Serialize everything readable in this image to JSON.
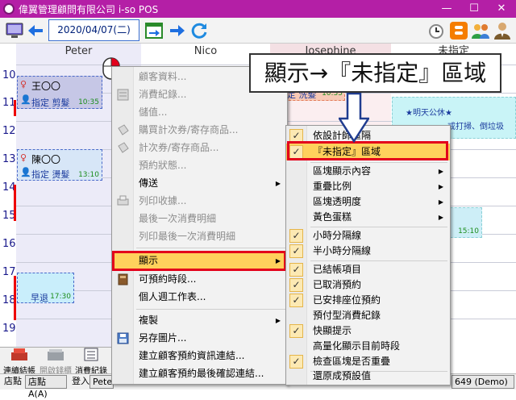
{
  "titlebar": {
    "title": "偉翼管理顧問有限公司 i-so POS",
    "minimize": "—",
    "maximize": "☐",
    "close": "✕"
  },
  "toolbar": {
    "date": "2020/04/07(二)"
  },
  "columns": [
    "Peter",
    "Nico",
    "Josephine",
    "未指定"
  ],
  "hours": [
    "10",
    "11",
    "12",
    "13",
    "14",
    "15",
    "16",
    "17",
    "18",
    "19"
  ],
  "appointments": [
    {
      "name": "王〇〇",
      "service": "指定 剪髮",
      "time": "10:35"
    },
    {
      "name": "陳〇〇",
      "service": "指定 燙髮",
      "time": "13:10"
    },
    {
      "name": "早退",
      "time": "17:30"
    },
    {
      "service": "定 洗髮",
      "time": "10:35"
    },
    {
      "name": "★明天公休★",
      "service": "戒打掃、倒垃圾"
    },
    {
      "time": "15:10"
    }
  ],
  "callout": "顯示→『未指定』區域",
  "context_menu": [
    {
      "label": "顧客資料...",
      "enabled": false
    },
    {
      "label": "消費紀錄...",
      "enabled": false
    },
    {
      "label": "儲值...",
      "enabled": false
    },
    {
      "label": "購買計次券/寄存商品...",
      "enabled": false
    },
    {
      "label": "計次券/寄存商品...",
      "enabled": false
    },
    {
      "label": "預約狀態...",
      "enabled": false
    },
    {
      "label": "傳送",
      "enabled": true
    },
    {
      "label": "列印收據...",
      "enabled": false
    },
    {
      "label": "最後一次消費明細",
      "enabled": false
    },
    {
      "label": "列印最後一次消費明細",
      "enabled": false
    },
    {
      "label": "顯示",
      "enabled": true
    },
    {
      "label": "可預約時段...",
      "enabled": true
    },
    {
      "label": "個人週工作表...",
      "enabled": true
    },
    {
      "label": "複製",
      "enabled": true
    },
    {
      "label": "另存圖片...",
      "enabled": true
    },
    {
      "label": "建立顧客預約資訊連結...",
      "enabled": true
    },
    {
      "label": "建立顧客預約最後確認連結...",
      "enabled": true
    }
  ],
  "submenu": [
    {
      "label": "依設計師區隔",
      "checked": true
    },
    {
      "label": "『未指定』區域",
      "checked": true
    },
    {
      "label": "區塊顯示內容",
      "checked": false
    },
    {
      "label": "重疊比例",
      "checked": false
    },
    {
      "label": "區塊透明度",
      "checked": false
    },
    {
      "label": "黃色蛋糕",
      "checked": false
    },
    {
      "label": "小時分隔線",
      "checked": true
    },
    {
      "label": "半小時分隔線",
      "checked": true
    },
    {
      "label": "已結帳項目",
      "checked": true
    },
    {
      "label": "已取消預約",
      "checked": true
    },
    {
      "label": "已安排座位預約",
      "checked": true
    },
    {
      "label": "預付型消費紀錄",
      "checked": false
    },
    {
      "label": "快顯提示",
      "checked": true
    },
    {
      "label": "高量化顯示目前時段",
      "checked": false
    },
    {
      "label": "檢查區塊是否重疊",
      "checked": true
    },
    {
      "label": "還原成預設值",
      "checked": false
    }
  ],
  "bottom_buttons": [
    "連續結帳",
    "開啟錢櫃",
    "消費紀錄"
  ],
  "statusbar": {
    "store_label": "店點",
    "store_value": "店點A(A)",
    "login_label": "登入",
    "login_value": "Pete",
    "version": "649 (Demo)"
  },
  "colors": {
    "titlebar": "#b41fa6",
    "highlight": "#ffd15c",
    "annot_red": "#e3001b",
    "peter_col": "#ecebf8"
  }
}
